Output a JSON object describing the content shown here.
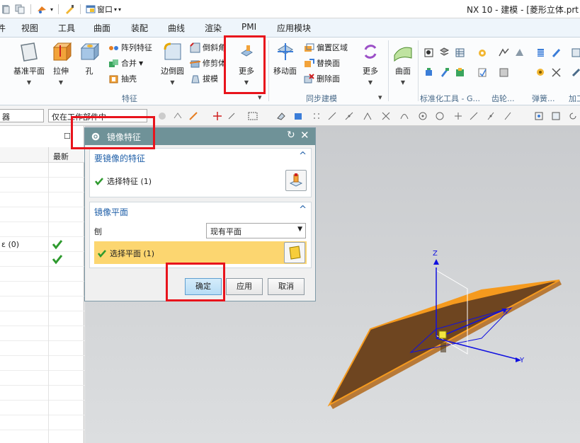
{
  "titlebar": {
    "window_menu": "窗口",
    "app_title": "NX 10 - 建模 - [菱形立体.prt"
  },
  "menu_tabs": [
    "件",
    "视图",
    "工具",
    "曲面",
    "装配",
    "曲线",
    "渲染",
    "PMI",
    "应用模块"
  ],
  "ribbon": {
    "datum_plane": "基准平面",
    "extrude": "拉伸",
    "hole": "孔",
    "pattern_feature": "阵列特征",
    "unite": "合并",
    "shell": "抽壳",
    "edge_blend": "边倒圆",
    "chamfer": "倒斜角",
    "trim_body": "修剪体",
    "draft": "拔模",
    "more_feature": "更多",
    "move_face": "移动面",
    "offset_region": "偏置区域",
    "replace_face": "替换面",
    "delete_face": "删除面",
    "more_sync": "更多",
    "surface": "曲面",
    "group_feature": "特征",
    "group_sync": "同步建模",
    "group_standard": "标准化工具 - G...",
    "group_gear": "齿轮...",
    "group_spring": "弹簧...",
    "group_add": "加工"
  },
  "selection_bar": {
    "type_filter": "器",
    "scope": "仅在工作部件中"
  },
  "navigator": {
    "col_latest": "最新",
    "rows": [
      {
        "text": "",
        "latest": false
      },
      {
        "text": "",
        "latest": false
      },
      {
        "text": "",
        "latest": false
      },
      {
        "text": "",
        "latest": false
      },
      {
        "text": "",
        "latest": false
      },
      {
        "text": "",
        "latest": false
      },
      {
        "text": "",
        "latest": false
      },
      {
        "text": "",
        "latest": false
      },
      {
        "text": "",
        "latest": false
      },
      {
        "text": "",
        "latest": false
      },
      {
        "text": "",
        "latest": false
      },
      {
        "text": "",
        "latest": false
      },
      {
        "text": "",
        "latest": false
      },
      {
        "text": "",
        "latest": false
      },
      {
        "text": "",
        "latest": false
      },
      {
        "text": "",
        "latest": false
      },
      {
        "text": "",
        "latest": false
      },
      {
        "text": "",
        "latest": false
      },
      {
        "text": "",
        "latest": false
      },
      {
        "text": "",
        "latest": false
      },
      {
        "text": "",
        "latest": false
      }
    ],
    "checked_row_1": "ε (0)",
    "checked_row_2": ""
  },
  "dialog": {
    "title": "镜像特征",
    "section1_title": "要镜像的特征",
    "select_feature": "选择特征 (1)",
    "section2_title": "镜像平面",
    "plane_label": "刨",
    "plane_option": "现有平面",
    "select_plane": "选择平面 (1)",
    "ok": "确定",
    "apply": "应用",
    "cancel": "取消"
  },
  "axes": {
    "z": "Z",
    "x": "X",
    "y": "Y"
  },
  "colors": {
    "accent_red": "#e8141c",
    "dialog_title": "#6f9298",
    "selection_highlight": "#fcd670",
    "plate_top": "#f59a1e",
    "plate_face": "#6e4520",
    "check_green": "#2e9a2e",
    "triad_blue": "#1010e0"
  }
}
